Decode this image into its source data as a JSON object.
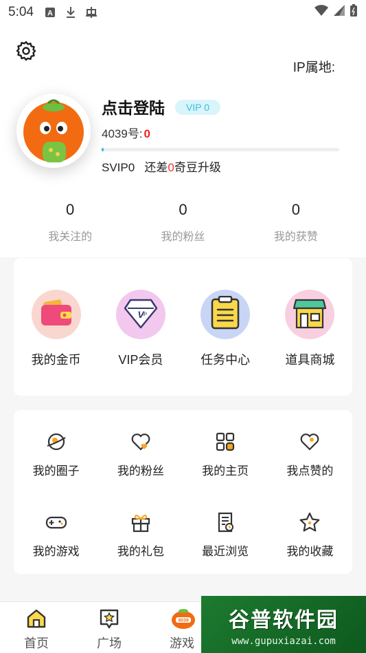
{
  "status_bar": {
    "time": "5:04"
  },
  "header": {
    "ip_label": "IP属地:"
  },
  "profile": {
    "name": "点击登陆",
    "vip_badge": "VIP 0",
    "id_label": "4039号:",
    "id_value": "0",
    "level_progress": 0.01,
    "svip_label": "SVIP0",
    "upgrade_prefix": "还差",
    "upgrade_value": "0",
    "upgrade_suffix": "奇豆升级"
  },
  "stats": [
    {
      "value": "0",
      "label": "我关注的"
    },
    {
      "value": "0",
      "label": "我的粉丝"
    },
    {
      "value": "0",
      "label": "我的获赞"
    }
  ],
  "features": [
    {
      "label": "我的金币",
      "icon": "wallet-icon",
      "bg": "#f9d7cf"
    },
    {
      "label": "VIP会员",
      "icon": "diamond-vip-icon",
      "bg": "#f3c8ee"
    },
    {
      "label": "任务中心",
      "icon": "task-clipboard-icon",
      "bg": "#c9d5f5"
    },
    {
      "label": "道具商城",
      "icon": "shop-icon",
      "bg": "#f8cfe0"
    }
  ],
  "grid": [
    {
      "label": "我的圈子",
      "icon": "planet-icon"
    },
    {
      "label": "我的粉丝",
      "icon": "heart-icon"
    },
    {
      "label": "我的主页",
      "icon": "apps-grid-icon"
    },
    {
      "label": "我点赞的",
      "icon": "heart-outline-icon"
    },
    {
      "label": "我的游戏",
      "icon": "gamepad-icon"
    },
    {
      "label": "我的礼包",
      "icon": "gift-icon"
    },
    {
      "label": "最近浏览",
      "icon": "history-icon"
    },
    {
      "label": "我的收藏",
      "icon": "star-icon"
    }
  ],
  "tabs": [
    {
      "label": "首页",
      "icon": "home-icon"
    },
    {
      "label": "广场",
      "icon": "square-badge-icon"
    },
    {
      "label": "游戏",
      "icon": "game-logo-icon"
    }
  ],
  "watermark": {
    "title": "谷普软件园",
    "url": "www.gupuxiazai.com"
  },
  "colors": {
    "accent": "#3bb8e4",
    "highlight": "#e22222",
    "icon_orange": "#f5a623"
  }
}
